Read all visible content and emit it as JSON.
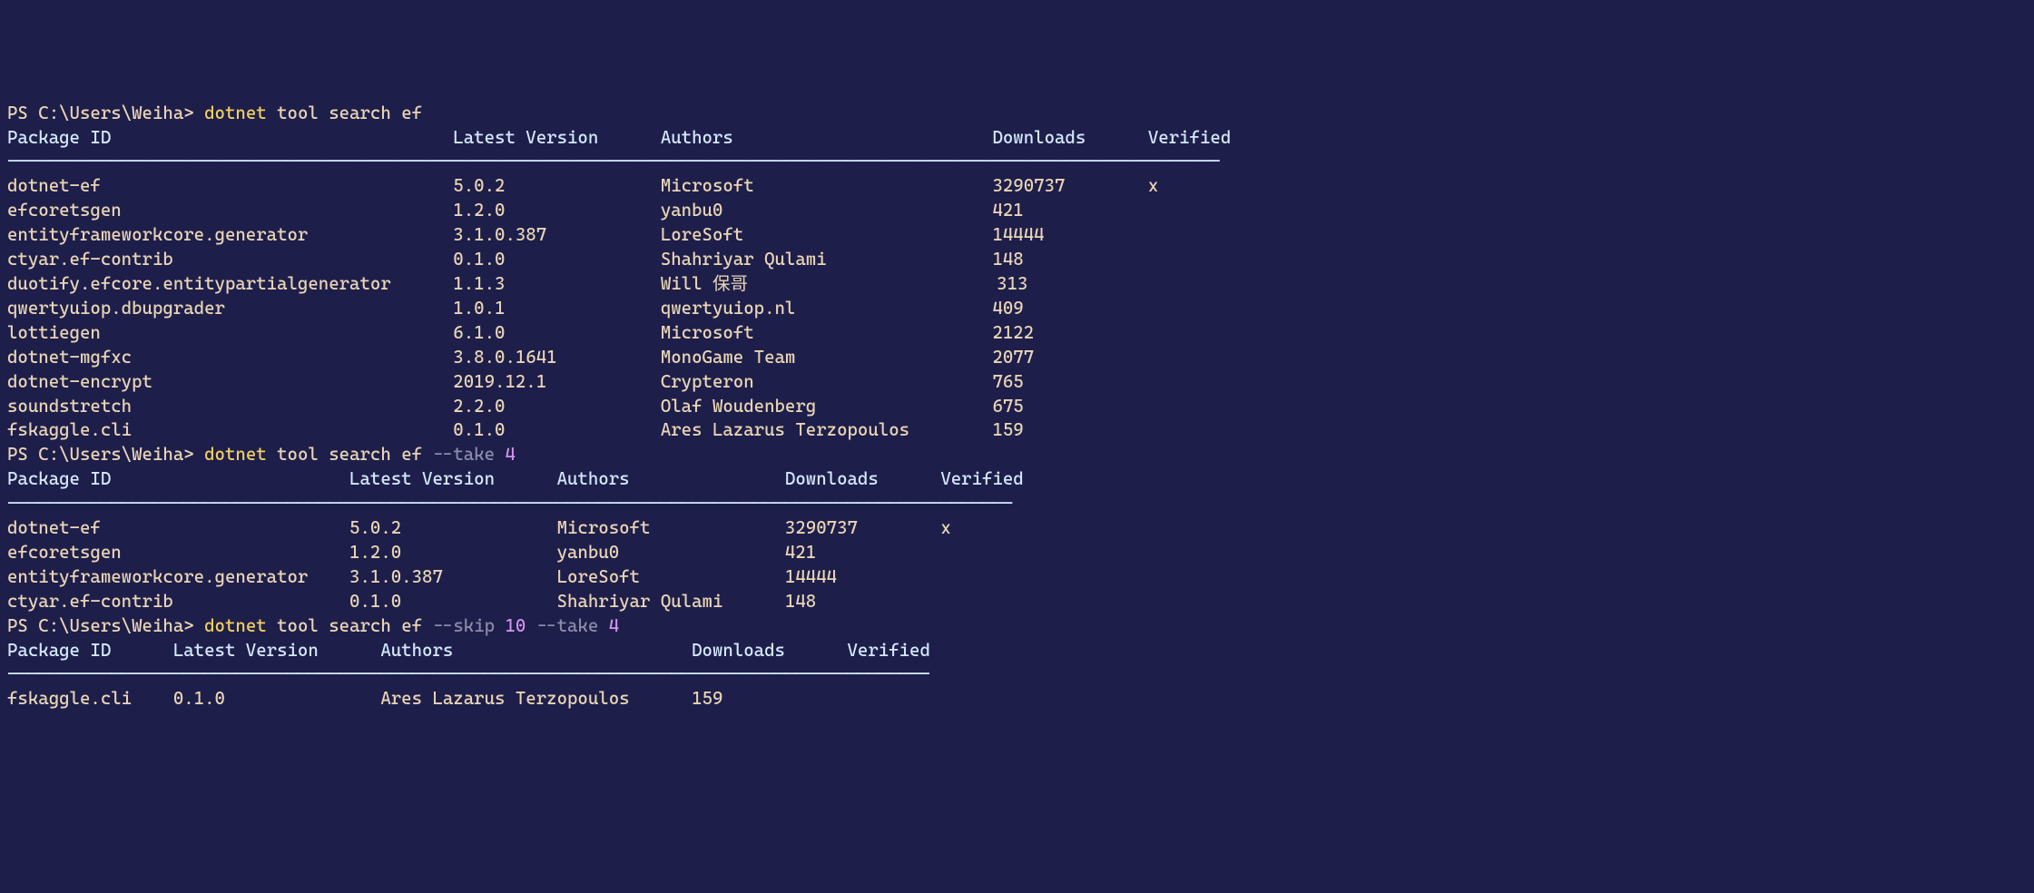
{
  "prompt": {
    "ps": "PS ",
    "path": "C:\\Users\\Weiha",
    "gt": "> "
  },
  "commands": {
    "cmd1": {
      "exe": "dotnet",
      "args": " tool search ef"
    },
    "cmd2": {
      "exe": "dotnet",
      "args_pre": " tool search ef ",
      "flag1": "--take",
      "num1": " 4"
    },
    "cmd3": {
      "exe": "dotnet",
      "args_pre": " tool search ef ",
      "flag1": "--skip",
      "num1": " 10 ",
      "flag2": "--take",
      "num2": " 4"
    }
  },
  "table1": {
    "header": "Package ID                                 Latest Version      Authors                         Downloads      Verified",
    "dashes": "---------------------------------------------------------------------------------------------------------------------",
    "rows": [
      "dotnet-ef                                  5.0.2               Microsoft                       3290737        x",
      "efcoretsgen                                1.2.0               yanbu0                          421",
      "entityframeworkcore.generator              3.1.0.387           LoreSoft                        14444",
      "ctyar.ef-contrib                           0.1.0               Shahriyar Qulami                148",
      "duotify.efcore.entitypartialgenerator      1.1.3               Will 保哥                        313",
      "qwertyuiop.dbupgrader                      1.0.1               qwertyuiop.nl                   409",
      "lottiegen                                  6.1.0               Microsoft                       2122",
      "dotnet-mgfxc                               3.8.0.1641          MonoGame Team                   2077",
      "dotnet-encrypt                             2019.12.1           Crypteron                       765",
      "soundstretch                               2.2.0               Olaf Woudenberg                 675",
      "fskaggle.cli                               0.1.0               Ares Lazarus Terzopoulos        159"
    ]
  },
  "table2": {
    "header": "Package ID                       Latest Version      Authors               Downloads      Verified",
    "dashes": "-------------------------------------------------------------------------------------------------",
    "rows": [
      "dotnet-ef                        5.0.2               Microsoft             3290737        x",
      "efcoretsgen                      1.2.0               yanbu0                421",
      "entityframeworkcore.generator    3.1.0.387           LoreSoft              14444",
      "ctyar.ef-contrib                 0.1.0               Shahriyar Qulami      148"
    ]
  },
  "table3": {
    "header": "Package ID      Latest Version      Authors                       Downloads      Verified",
    "dashes": "-----------------------------------------------------------------------------------------",
    "rows": [
      "fskaggle.cli    0.1.0               Ares Lazarus Terzopoulos      159"
    ]
  }
}
